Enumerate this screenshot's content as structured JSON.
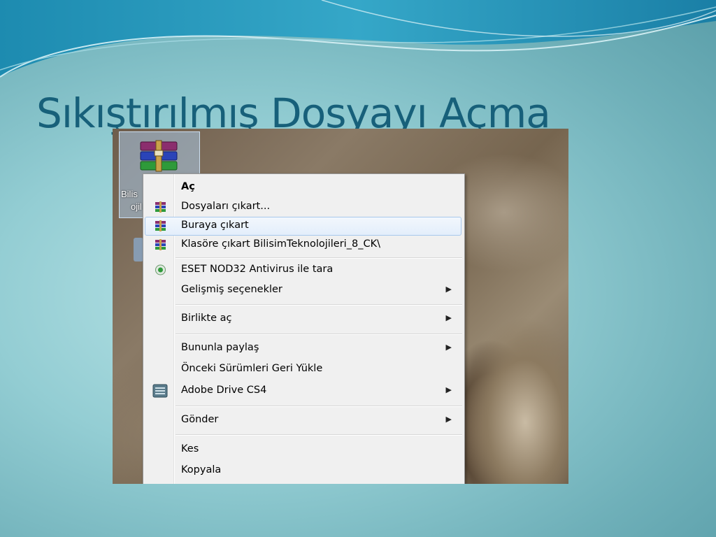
{
  "slide": {
    "title": "Sıkıştırılmış Dosyayı Açma"
  },
  "desktop_icon": {
    "label_line1": "Bilis",
    "label_line2": "ojil",
    "icon": "winrar-archive-icon"
  },
  "context_menu": {
    "items": [
      {
        "label": "Aç",
        "bold": true
      },
      {
        "label": "Dosyaları çıkart...",
        "icon": "winrar-icon"
      },
      {
        "label": "Buraya çıkart",
        "icon": "winrar-icon",
        "highlighted": true
      },
      {
        "label": "Klasöre çıkart BilisimTeknolojileri_8_CK\\",
        "icon": "winrar-icon"
      },
      {
        "label": "ESET NOD32 Antivirus ile tara",
        "icon": "eset-icon"
      },
      {
        "label": "Gelişmiş seçenekler",
        "submenu": true
      },
      {
        "label": "Birlikte aç",
        "submenu": true
      },
      {
        "label": "Bununla paylaş",
        "submenu": true
      },
      {
        "label": "Önceki Sürümleri Geri Yükle"
      },
      {
        "label": "Adobe Drive CS4",
        "icon": "adobe-drive-icon",
        "submenu": true
      },
      {
        "label": "Gönder",
        "submenu": true
      },
      {
        "label": "Kes"
      },
      {
        "label": "Kopyala"
      }
    ]
  },
  "colors": {
    "title": "#17607a",
    "menu_bg": "#f0f0f0",
    "highlight_border": "#a8c8ec"
  }
}
